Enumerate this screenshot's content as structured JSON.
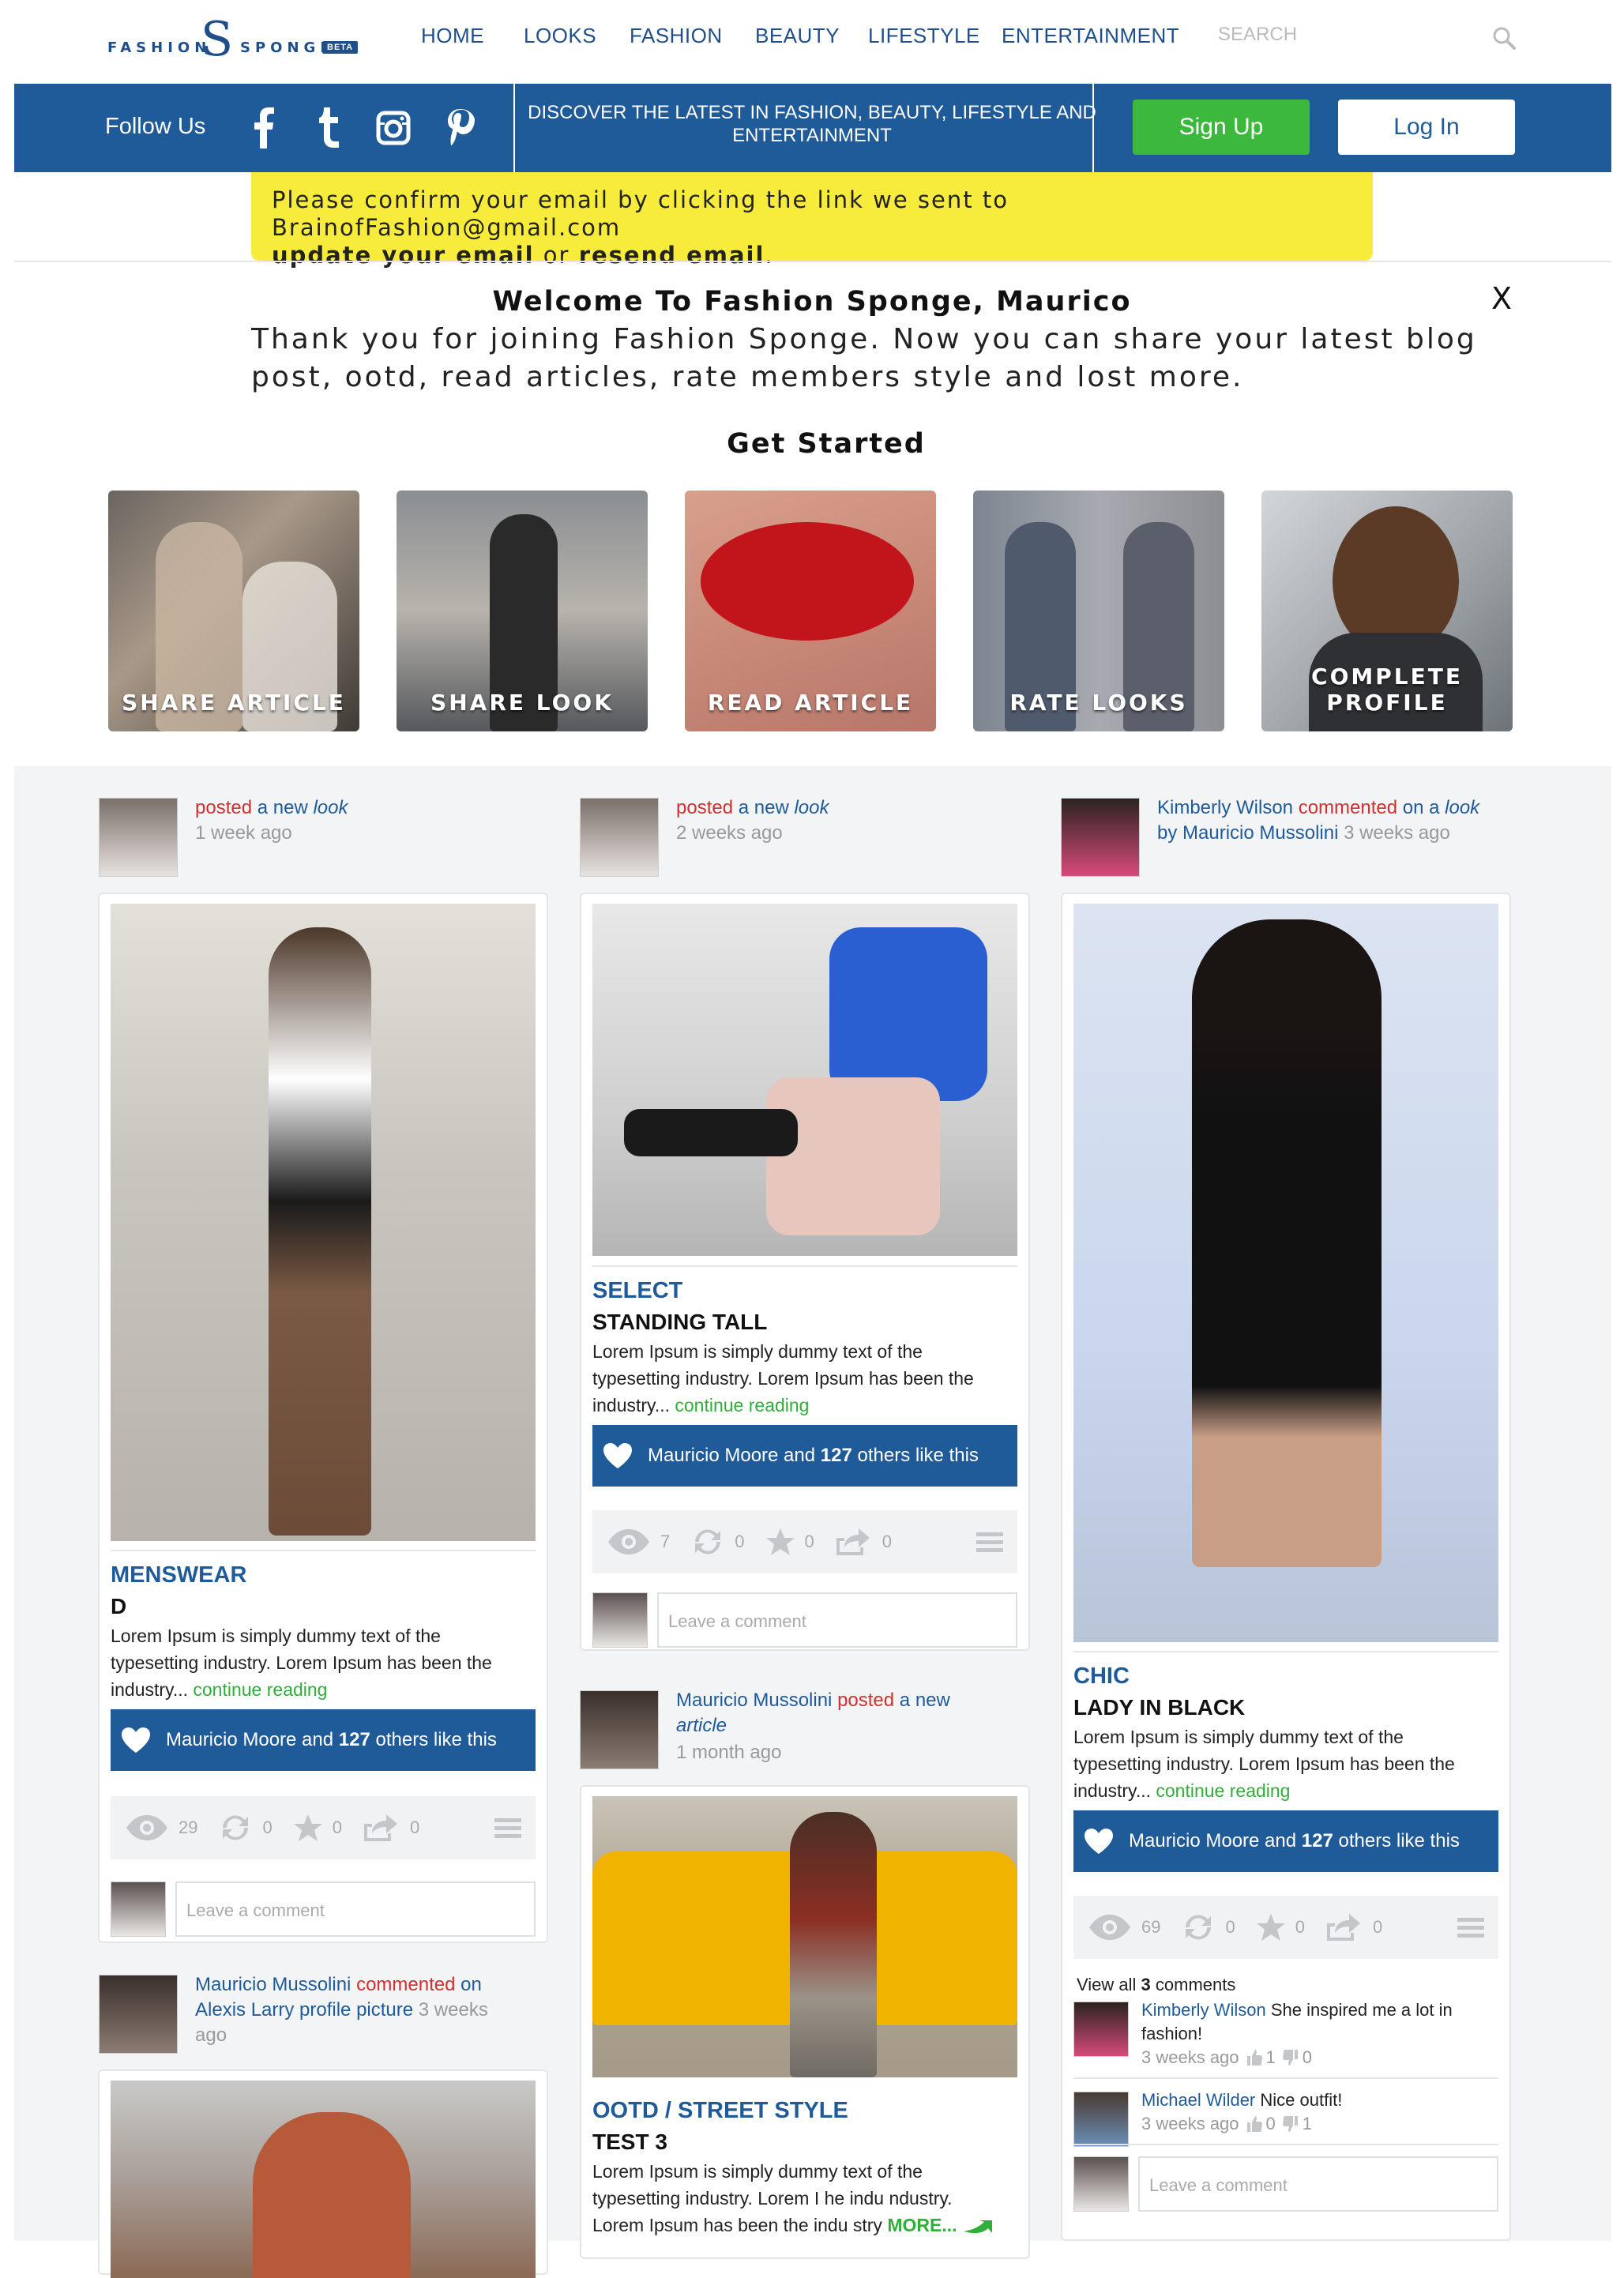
{
  "brand": {
    "left": "FASHION",
    "right": "SPONGE",
    "badge": "BETA",
    "color": "#1f4f8b"
  },
  "nav": {
    "items": [
      "HOME",
      "LOOKS",
      "FASHION",
      "BEAUTY",
      "LIFESTYLE",
      "ENTERTAINMENT"
    ],
    "search_placeholder": "SEARCH"
  },
  "bluebar": {
    "follow": "Follow Us",
    "social_icons": [
      "facebook-icon",
      "tumblr-icon",
      "instagram-icon",
      "pinterest-icon"
    ],
    "tagline": "DISCOVER THE LATEST IN FASHION, BEAUTY, LIFESTYLE AND ENTERTAINMENT",
    "signup": "Sign Up",
    "login": "Log In"
  },
  "banner": {
    "line1": "Please confirm your email by clicking the link we sent to BrainofFashion@gmail.com",
    "update": "update your email",
    "or": "or",
    "resend": "resend email",
    "period": "."
  },
  "welcome": {
    "title": "Welcome To Fashion Sponge, Maurico",
    "text1": "Thank you for joining Fashion Sponge. Now you can share your latest blog",
    "text2": "post, ootd, read articles, rate members style and lost more.",
    "close": "X",
    "get_started": "Get Started",
    "tiles": [
      "SHARE ARTICLE",
      "SHARE LOOK",
      "READ ARTICLE",
      "RATE LOOKS",
      "COMPLETE PROFILE"
    ]
  },
  "feed": {
    "col1": {
      "act1": {
        "verb": "posted",
        "mid": "a new",
        "obj": "look",
        "time": "1 week ago"
      },
      "post1": {
        "category": "MENSWEAR",
        "title": "D",
        "excerpt1": "Lorem Ipsum is simply dummy text of the",
        "excerpt2": "typesetting industry. Lorem Ipsum has been the",
        "excerpt3": "industry...",
        "continue": "continue reading",
        "likes_pre": "Mauricio Moore and",
        "likes_num": "127",
        "likes_post": "others like this",
        "views": "29",
        "reposts": "0",
        "stars": "0",
        "shares": "0",
        "comment_placeholder": "Leave a comment"
      },
      "act2": {
        "name": "Mauricio Mussolini",
        "verb": "commented",
        "on": "on",
        "target": "Alexis Larry profile picture",
        "time1": "3 weeks",
        "time2": "ago"
      }
    },
    "col2": {
      "act1": {
        "verb": "posted",
        "mid": "a new",
        "obj": "look",
        "time": "2 weeks ago"
      },
      "post1": {
        "category": "SELECT",
        "title": "STANDING TALL",
        "excerpt1": "Lorem Ipsum is simply dummy text of the",
        "excerpt2": "typesetting industry. Lorem Ipsum has been the",
        "excerpt3": "industry...",
        "continue": "continue reading",
        "likes_pre": "Mauricio Moore and",
        "likes_num": "127",
        "likes_post": "others like this",
        "views": "7",
        "reposts": "0",
        "stars": "0",
        "shares": "0",
        "comment_placeholder": "Leave a comment"
      },
      "act2": {
        "name": "Mauricio Mussolini",
        "verb": "posted",
        "mid": "a new",
        "obj": "article",
        "time": "1 month ago"
      },
      "post2": {
        "category": "OOTD / STREET STYLE",
        "title": "TEST 3",
        "excerpt1": "Lorem Ipsum is simply dummy text of the",
        "excerpt2": "typesetting industry. Lorem I he indu ndustry.",
        "excerpt3": "Lorem Ipsum has been the indu stry",
        "more": "MORE..."
      }
    },
    "col3": {
      "act1": {
        "name": "Kimberly Wilson",
        "verb": "commented",
        "on": "on a",
        "obj": "look",
        "by": "by Mauricio Mussolini",
        "time": "3 weeks ago"
      },
      "post1": {
        "category": "CHIC",
        "title": "LADY IN BLACK",
        "excerpt1": "Lorem Ipsum is simply dummy text of the",
        "excerpt2": "typesetting industry. Lorem Ipsum has been the",
        "excerpt3": "industry...",
        "continue": "continue reading",
        "likes_pre": "Mauricio Moore and",
        "likes_num": "127",
        "likes_post": "others like this",
        "views": "69",
        "reposts": "0",
        "stars": "0",
        "shares": "0",
        "view_all_pre": "View all",
        "view_all_num": "3",
        "view_all_post": "comments",
        "comments": [
          {
            "name": "Kimberly Wilson",
            "text1": "She inspired me a lot in",
            "text2": "fashion!",
            "time": "3 weeks ago",
            "up": "1",
            "down": "0"
          },
          {
            "name": "Michael Wilder",
            "text1": "Nice outfit!",
            "time": "3 weeks ago",
            "up": "0",
            "down": "1"
          }
        ],
        "comment_placeholder": "Leave a comment"
      }
    }
  },
  "colors": {
    "primary": "#1f5a99",
    "accent_green": "#3cb83c",
    "banner_yellow": "#f7ec3b",
    "alert_red": "#d0312d"
  }
}
